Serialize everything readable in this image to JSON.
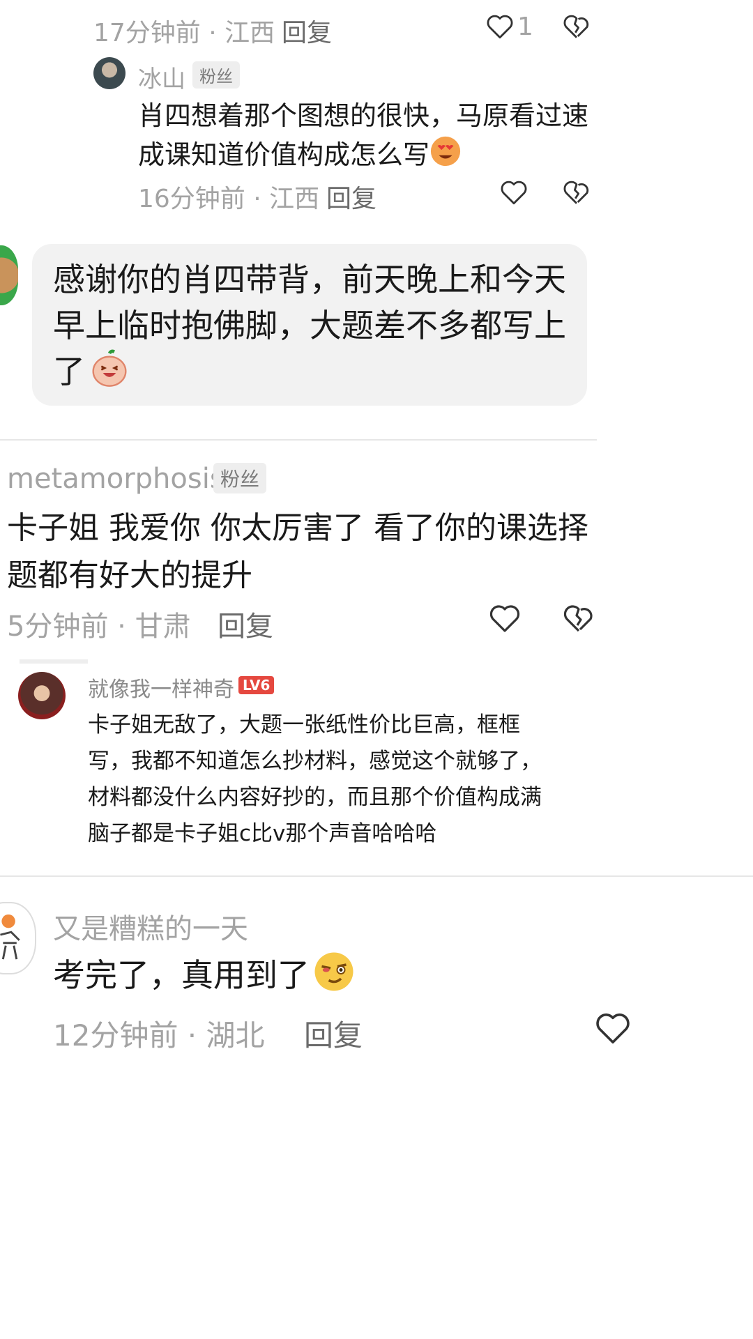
{
  "c1": {
    "time_loc": "17分钟前 · 江西",
    "reply": "回复",
    "likes": "1",
    "icons": [
      "heart-outline",
      "broken-heart-outline"
    ]
  },
  "c2": {
    "username": "冰山",
    "badge": "粉丝",
    "text": "肖四想着那个图想的很快，马原看过速成课知道价值构成怎么写",
    "emoji": "heart-eyes",
    "time_loc": "16分钟前 · 江西",
    "reply": "回复"
  },
  "c3": {
    "text_l1": "感谢你的肖四带背，前天晚上和今天",
    "text_l2": "早上临时抱佛脚，大题差不多都写上",
    "text_l3": "了",
    "emoji": "laughing-blob"
  },
  "c4": {
    "username": "metamorphosis",
    "badge": "粉丝",
    "text_l1": "卡子姐 我爱你 你太厉害了  看了你的课选择",
    "text_l2": "题都有好大的提升",
    "time_loc": "5分钟前 · 甘肃",
    "reply": "回复"
  },
  "c5": {
    "username": "就像我一样神奇",
    "level": "LV6",
    "l1": "卡子姐无敌了，大题一张纸性价比巨高，框框",
    "l2": "写，我都不知道怎么抄材料，感觉这个就够了，",
    "l3": "材料都没什么内容好抄的，而且那个价值构成满",
    "l4": "脑子都是卡子姐c比v那个声音哈哈哈"
  },
  "c6": {
    "username": "又是糟糕的一天",
    "text": "考完了，真用到了",
    "emoji": "smirk-face",
    "time_loc": "12分钟前 · 湖北",
    "reply": "回复"
  },
  "colors": {
    "meta": "#a3a3a3",
    "level_badge": "#e5483f",
    "bubble": "#f2f2f2"
  }
}
